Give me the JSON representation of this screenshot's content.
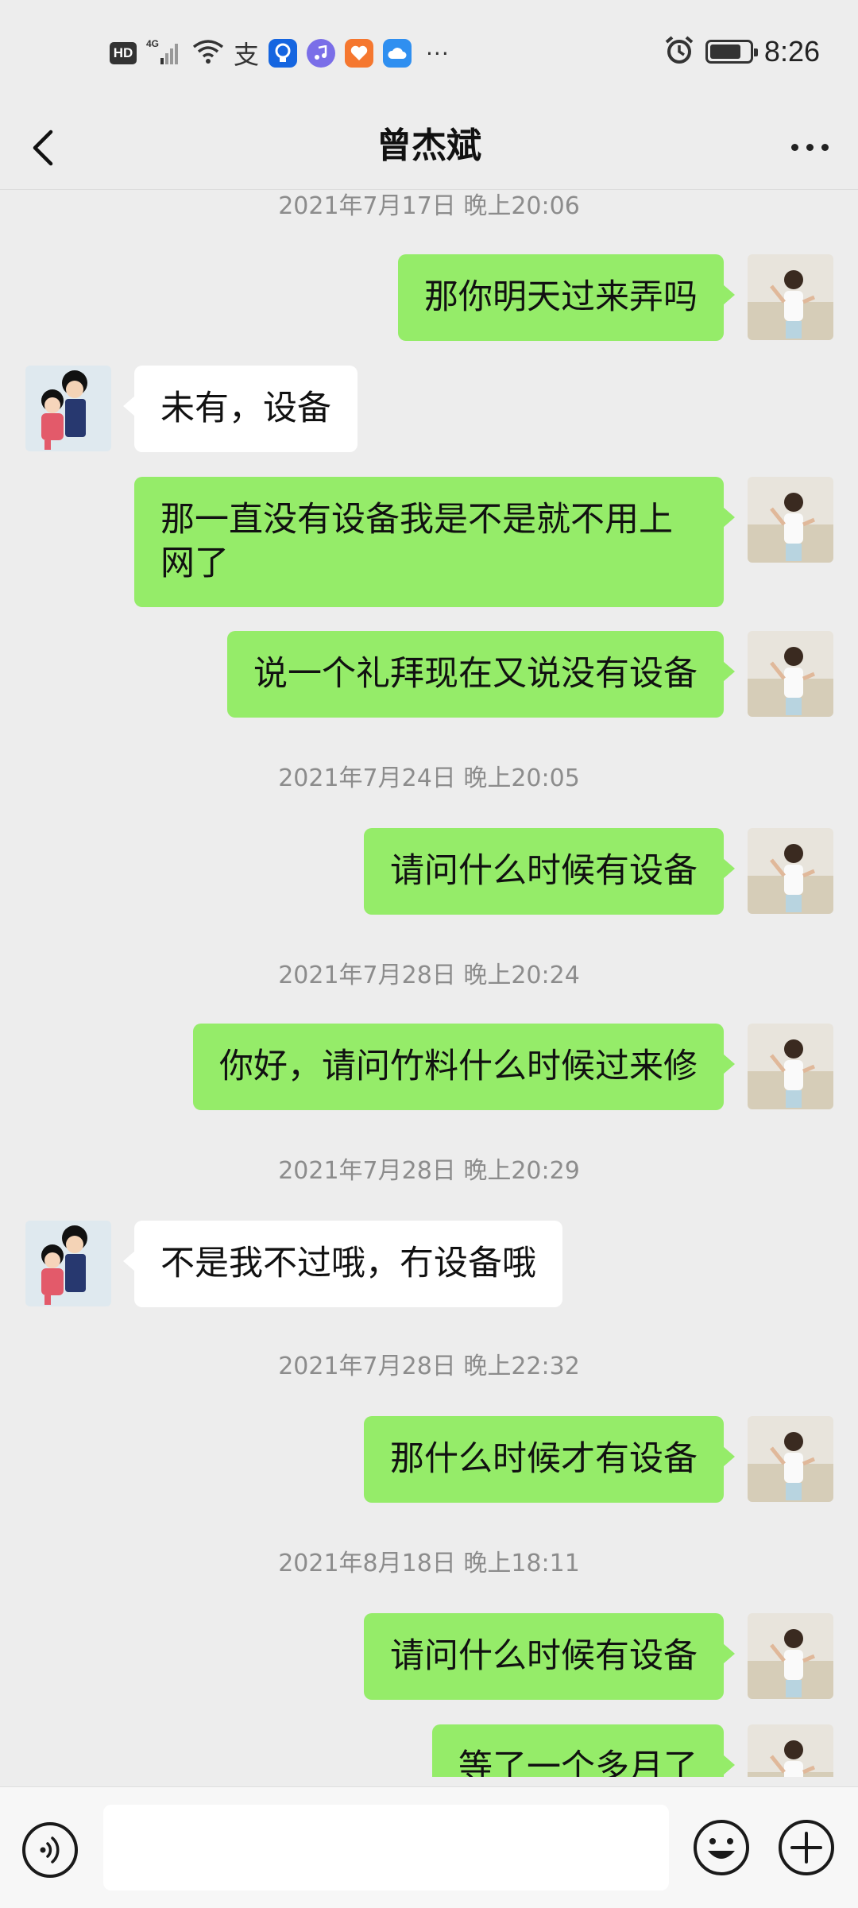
{
  "status_bar": {
    "time": "8:26",
    "left_icons": [
      "hd-badge",
      "4g-signal-icon",
      "wifi-icon",
      "alipay-icon",
      "lightbulb-app-icon",
      "music-app-icon",
      "health-app-icon",
      "cloud-app-icon"
    ],
    "hd_label": "HD",
    "alipay_glyph": "支",
    "more_glyph": "···",
    "right_icons": [
      "alarm-icon",
      "battery-icon"
    ]
  },
  "nav": {
    "title": "曾杰斌",
    "back_icon": "chevron-left-icon",
    "more_icon": "more-horizontal-icon"
  },
  "chat": {
    "timestamps": [
      "2021年7月17日 晚上20:06",
      "2021年7月24日 晚上20:05",
      "2021年7月28日 晚上20:24",
      "2021年7月28日 晚上20:29",
      "2021年7月28日 晚上22:32",
      "2021年8月18日 晚上18:11"
    ],
    "messages": [
      {
        "from": "me",
        "text": "那你明天过来弄吗"
      },
      {
        "from": "other",
        "text": "未有，设备"
      },
      {
        "from": "me",
        "text": "那一直没有设备我是不是就不用上网了"
      },
      {
        "from": "me",
        "text": "说一个礼拜现在又说没有设备"
      },
      {
        "from": "me",
        "text": "请问什么时候有设备"
      },
      {
        "from": "me",
        "text": "你好，请问竹料什么时候过来修"
      },
      {
        "from": "other",
        "text": "不是我不过哦，冇设备哦"
      },
      {
        "from": "me",
        "text": "那什么时候才有设备"
      },
      {
        "from": "me",
        "text": "请问什么时候有设备"
      },
      {
        "from": "me",
        "text": "等了一个多月了"
      }
    ]
  },
  "input_bar": {
    "voice_icon": "voice-input-icon",
    "emoji_icon": "emoji-icon",
    "plus_icon": "plus-circle-icon",
    "value": ""
  },
  "colors": {
    "background": "#ededed",
    "my_bubble": "#95ec69",
    "other_bubble": "#ffffff",
    "timestamp": "#8c8c8c"
  }
}
